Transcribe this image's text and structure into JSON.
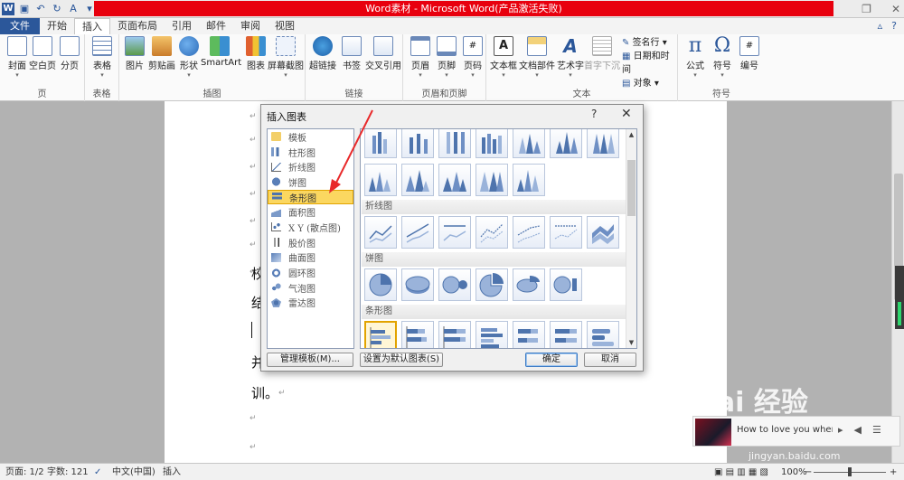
{
  "window": {
    "title": "Word素材 - Microsoft Word(产品激活失败)",
    "qat_icons": [
      "word-logo-icon",
      "save-icon",
      "undo-icon",
      "redo-icon",
      "customize-icon"
    ]
  },
  "tabs": [
    "文件",
    "开始",
    "插入",
    "页面布局",
    "引用",
    "邮件",
    "审阅",
    "视图"
  ],
  "active_tab": "插入",
  "ribbon": {
    "groups": {
      "pages": "页",
      "tables": "表格",
      "illustrations": "插图",
      "links": "链接",
      "header_footer": "页眉和页脚",
      "text": "文本",
      "symbols": "符号"
    },
    "buttons": {
      "cover": "封面",
      "blank_page": "空白页",
      "page_break": "分页",
      "table": "表格",
      "picture": "图片",
      "clipart": "剪贴画",
      "shapes": "形状",
      "smartart": "SmartArt",
      "chart": "图表",
      "screenshot": "屏幕截图",
      "hyperlink": "超链接",
      "bookmark": "书签",
      "cross_ref": "交叉引用",
      "header": "页眉",
      "footer": "页脚",
      "page_number": "页码",
      "textbox": "文本框",
      "quick_parts": "文档部件",
      "wordart": "艺术字",
      "drop_cap": "首字下沉",
      "signature_line": "签名行",
      "date_time": "日期和时间",
      "object": "对象",
      "equation": "公式",
      "symbol": "符号",
      "number": "编号"
    }
  },
  "document": {
    "lines": [
      "校",
      "结",
      "并",
      "训。"
    ]
  },
  "dialog": {
    "title": "插入图表",
    "help": "?",
    "close": "✕",
    "categories": [
      {
        "label": "模板",
        "icon": "folder-icon"
      },
      {
        "label": "柱形图",
        "icon": "column-chart-icon"
      },
      {
        "label": "折线图",
        "icon": "line-chart-icon"
      },
      {
        "label": "饼图",
        "icon": "pie-chart-icon"
      },
      {
        "label": "条形图",
        "icon": "bar-chart-icon"
      },
      {
        "label": "面积图",
        "icon": "area-chart-icon"
      },
      {
        "label": "X Y (散点图)",
        "icon": "scatter-chart-icon"
      },
      {
        "label": "股价图",
        "icon": "stock-chart-icon"
      },
      {
        "label": "曲面图",
        "icon": "surface-chart-icon"
      },
      {
        "label": "圆环图",
        "icon": "doughnut-chart-icon"
      },
      {
        "label": "气泡图",
        "icon": "bubble-chart-icon"
      },
      {
        "label": "雷达图",
        "icon": "radar-chart-icon"
      }
    ],
    "selected_category": "条形图",
    "sections": {
      "line": "折线图",
      "pie": "饼图",
      "bar": "条形图"
    },
    "buttons": {
      "manage_templates": "管理模板(M)...",
      "set_default": "设置为默认图表(S)",
      "ok": "确定",
      "cancel": "取消"
    }
  },
  "video_popup": {
    "title": "How to love you when th"
  },
  "watermark": {
    "brand": "Bai 经验",
    "url": "jingyan.baidu.com"
  },
  "status": {
    "page": "页面: 1/2",
    "words": "字数: 121",
    "language": "中文(中国)",
    "mode": "插入",
    "zoom": "100%"
  },
  "colors": {
    "file_tab": "#2b579a",
    "title_red": "#e8000e",
    "selection": "#fbd760",
    "annotation_arrow": "#e8292a"
  }
}
